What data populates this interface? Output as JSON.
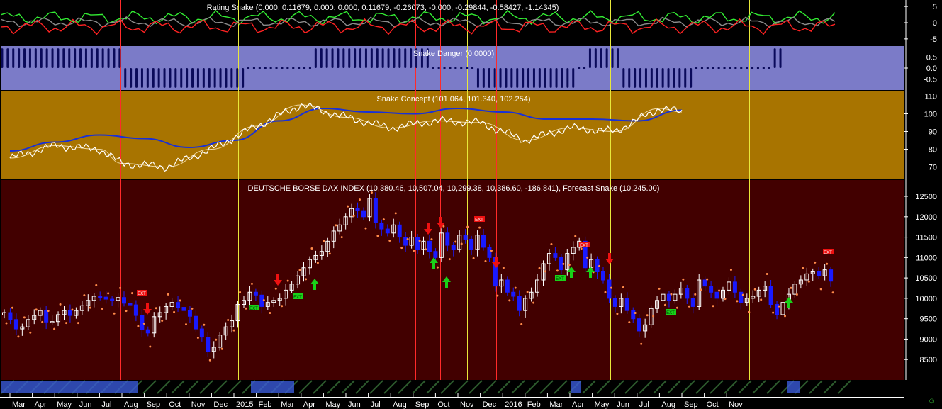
{
  "colors": {
    "background": "#000000",
    "rating_bg": "#000000",
    "danger_bg": "#7b7bc8",
    "concept_bg": "#a87400",
    "price_bg": "#420000",
    "bull": "#ffffff",
    "bear": "#1a1aff",
    "forecast_dots": "#ff8a4a",
    "buy_arrow": "#19d119",
    "sell_arrow": "#ee1111",
    "vline_red": "#ff2a2a",
    "vline_yellow": "#e8e83a",
    "vline_green": "#3ccf3c",
    "concept_ma": "#1830d8",
    "rating_green": "#33ee33",
    "rating_red": "#ff2222"
  },
  "chart_data": [
    {
      "type": "line",
      "panel": "rating",
      "title": "Rating Snake (0.000, 0.11679, 0.000, 0.000, 0.11679, -0.26073, -0.000, -0.29844, -0.58427, -1.14345)",
      "ylim": [
        -7,
        7
      ],
      "yticks": [
        "5",
        "0",
        "-5"
      ]
    },
    {
      "type": "bar",
      "panel": "danger",
      "title": "Snake Danger (0.0000)",
      "ylim": [
        -1,
        1
      ],
      "yticks": [
        "0.5",
        "0.0",
        "-0.5"
      ],
      "pattern_by_segment": [
        {
          "from": "2014-03",
          "to": "2014-07",
          "value": 1
        },
        {
          "from": "2014-08",
          "to": "2014-11",
          "value": -1
        },
        {
          "from": "2014-12",
          "to": "2015-06",
          "value": 1
        },
        {
          "from": "2015-07",
          "to": "2015-11",
          "value": -1
        },
        {
          "from": "2015-11",
          "to": "2015-12",
          "value": 1
        },
        {
          "from": "2015-12",
          "to": "2016-07",
          "value": -1
        },
        {
          "from": "2016-07",
          "to": "2016-09",
          "value": 1
        }
      ]
    },
    {
      "type": "line",
      "panel": "concept",
      "title": "Snake Concept (101.064, 101.340, 102.254)",
      "ylim": [
        63,
        113
      ],
      "yticks": [
        "110",
        "100",
        "90",
        "80",
        "70"
      ],
      "series": [
        {
          "name": "",
          "x": [
            "2014-03",
            "2014-05",
            "2014-07",
            "2014-09",
            "2014-11",
            "2015-01",
            "2015-03",
            "2015-05",
            "2015-07",
            "2015-09",
            "2015-11",
            "2016-01",
            "2016-03",
            "2016-05",
            "2016-07",
            "2016-09"
          ],
          "values": [
            79,
            84,
            88,
            86,
            81,
            85,
            96,
            103,
            101,
            100,
            103,
            101,
            97,
            97,
            96,
            102
          ]
        },
        {
          "name": "",
          "x": [
            "2014-03",
            "2014-05",
            "2014-07",
            "2014-08",
            "2014-10",
            "2014-12",
            "2015-02",
            "2015-04",
            "2015-06",
            "2015-08",
            "2015-10",
            "2015-12",
            "2016-02",
            "2016-04",
            "2016-06",
            "2016-08",
            "2016-09"
          ],
          "values": [
            75,
            82,
            80,
            72,
            70,
            80,
            93,
            105,
            98,
            92,
            96,
            95,
            85,
            92,
            90,
            103,
            101
          ]
        }
      ]
    },
    {
      "type": "candlestick",
      "panel": "price",
      "title": "DEUTSCHE BORSE DAX INDEX (10,380.46, 10,507.04, 10,299.38, 10,386.60, -186.841), Forecast Snake (10,245.00)",
      "ylim": [
        8000,
        12900
      ],
      "yticks": [
        "12500",
        "12000",
        "11500",
        "11000",
        "10500",
        "10000",
        "9500",
        "9000",
        "8500"
      ],
      "closes": [
        9650,
        9480,
        9250,
        9300,
        9480,
        9580,
        9700,
        9420,
        9430,
        9600,
        9700,
        9580,
        9700,
        9820,
        9950,
        10050,
        10030,
        9980,
        9950,
        10020,
        9880,
        9840,
        9580,
        9230,
        9150,
        9550,
        9650,
        9800,
        9900,
        9780,
        9700,
        9560,
        9250,
        9050,
        8700,
        8800,
        9100,
        9300,
        9450,
        9850,
        9950,
        10150,
        10080,
        9800,
        9900,
        9950,
        10000,
        10200,
        10350,
        10550,
        10750,
        10950,
        11050,
        11150,
        11400,
        11650,
        11800,
        12000,
        12200,
        12150,
        12000,
        12450,
        11850,
        11700,
        11600,
        11800,
        11500,
        11300,
        11500,
        11200,
        11400,
        11150,
        11000,
        11600,
        11300,
        11200,
        11550,
        11450,
        11200,
        11550,
        11250,
        11000,
        10300,
        10450,
        10150,
        10050,
        9700,
        10000,
        10150,
        10450,
        10850,
        11100,
        11000,
        10700,
        11100,
        11250,
        11400,
        10750,
        10950,
        10650,
        10450,
        10000,
        9800,
        10000,
        9700,
        9500,
        9200,
        9350,
        9750,
        9950,
        10100,
        9950,
        10100,
        10250,
        10000,
        9800,
        10450,
        10300,
        10150,
        10000,
        10200,
        10400,
        10150,
        9900,
        10000,
        10050,
        10200,
        10300,
        9850,
        9600,
        9900,
        10100,
        10350,
        10450,
        10600,
        10650,
        10550,
        10700,
        10420
      ]
    }
  ],
  "x_axis": {
    "labels": [
      "Mar",
      "Apr",
      "May",
      "Jun",
      "Jul",
      "Aug",
      "Sep",
      "Oct",
      "Nov",
      "Dec",
      "2015",
      "Feb",
      "Mar",
      "Apr",
      "May",
      "Jun",
      "Jul",
      "Aug",
      "Sep",
      "Oct",
      "Nov",
      "Dec",
      "2016",
      "Feb",
      "Mar",
      "Apr",
      "May",
      "Jun",
      "Jul",
      "Aug",
      "Sep",
      "Oct",
      "Nov"
    ]
  },
  "signals": {
    "sell_labels": [
      "EXT",
      "EXT",
      "EXT",
      "EXT"
    ],
    "buy_labels": [
      "EXT",
      "EXT",
      "EXT",
      "EXT",
      "EXT"
    ]
  },
  "corner_glyph": "☺"
}
